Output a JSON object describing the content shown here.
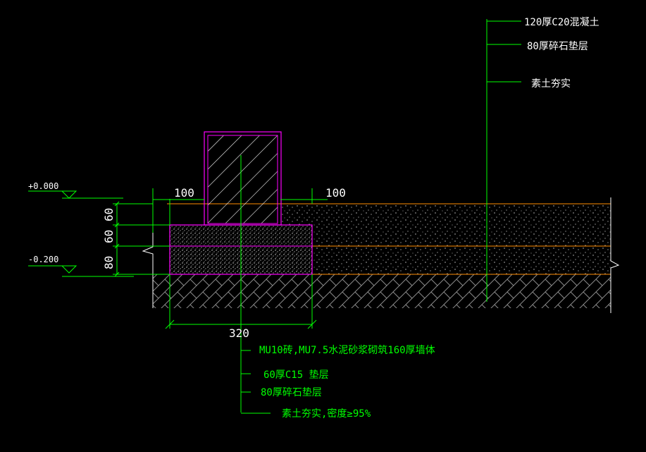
{
  "labels": {
    "top_callouts": [
      "120厚C20混凝土",
      "80厚碎石垫层",
      "素土夯实"
    ],
    "bottom_callouts": [
      "MU10砖,MU7.5水泥砂浆砌筑160厚墙体",
      "60厚C15  垫层",
      "80厚碎石垫层",
      "素土夯实,密度≥95%"
    ],
    "elevations": [
      "+0.000",
      "-0.200"
    ],
    "dims": {
      "left_offset": "100",
      "right_offset": "100",
      "base_width": "320",
      "vertical": [
        "60",
        "60",
        "80"
      ]
    }
  },
  "colors": {
    "background": "#000000",
    "leader": "#00ff00",
    "wall_outline": "#ff00ff",
    "layer_line": "#ff8c00",
    "hatch": "#c0c0c0",
    "text": "#ffffff",
    "callout_text": "#00ff00"
  }
}
